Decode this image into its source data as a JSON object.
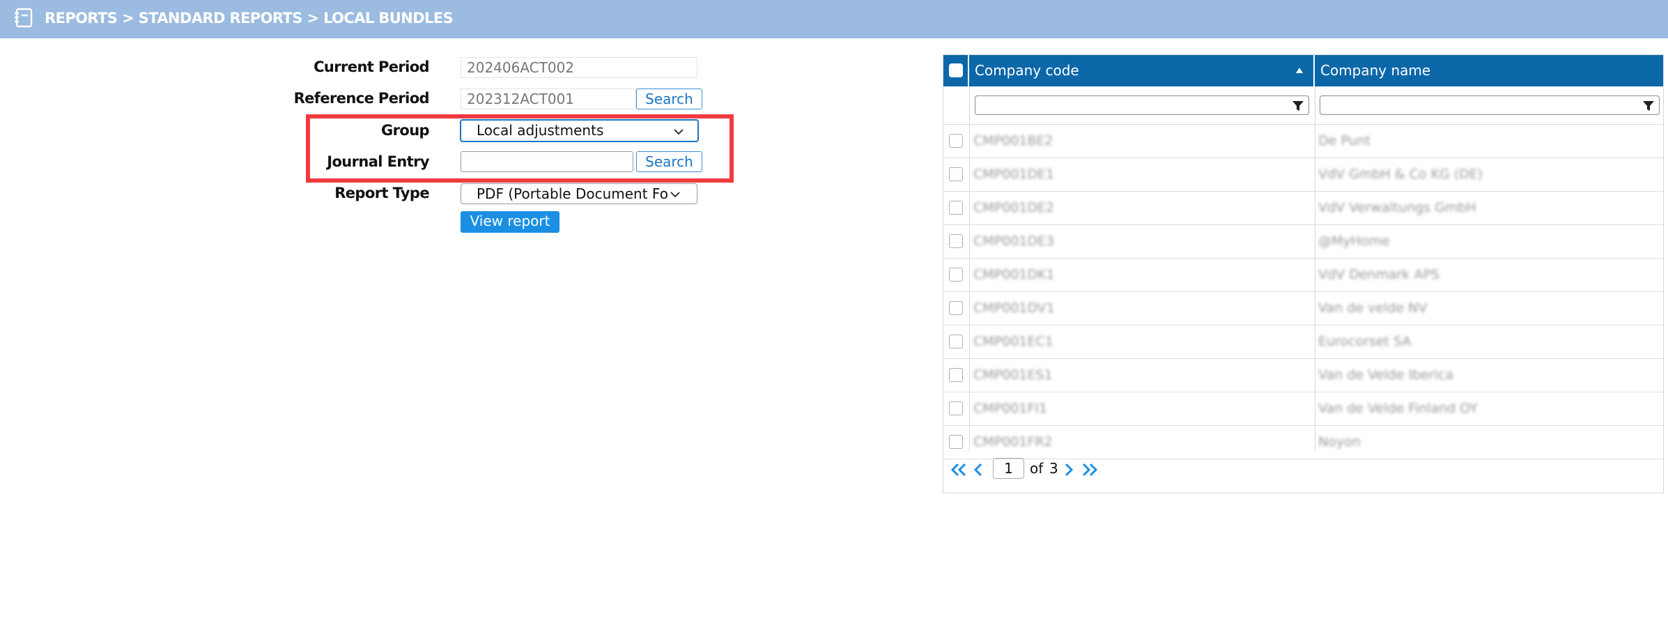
{
  "header": {
    "breadcrumb": "REPORTS > STANDARD REPORTS > LOCAL BUNDLES",
    "icon": "report-book-icon"
  },
  "form": {
    "current_period": {
      "label": "Current Period",
      "value": "202406ACT002"
    },
    "reference_period": {
      "label": "Reference Period",
      "value": "202312ACT001",
      "button": "Search"
    },
    "group": {
      "label": "Group",
      "value": "Local adjustments"
    },
    "journal_entry": {
      "label": "Journal Entry",
      "value": "",
      "button": "Search"
    },
    "report_type": {
      "label": "Report Type",
      "value": "PDF (Portable Document Forr"
    },
    "view_button": "View report"
  },
  "grid": {
    "columns": [
      {
        "label": "Company code",
        "sort": "ascending"
      },
      {
        "label": "Company name"
      }
    ],
    "rows": [
      {
        "code": "CMP001BE2",
        "name": "De Punt"
      },
      {
        "code": "CMP001DE1",
        "name": "VdV GmbH & Co KG (DE)"
      },
      {
        "code": "CMP001DE2",
        "name": "VdV Verwaltungs GmbH"
      },
      {
        "code": "CMP001DE3",
        "name": "@MyHome"
      },
      {
        "code": "CMP001DK1",
        "name": "VdV Denmark APS"
      },
      {
        "code": "CMP001DV1",
        "name": "Van de velde NV"
      },
      {
        "code": "CMP001EC1",
        "name": "Eurocorset SA"
      },
      {
        "code": "CMP001ES1",
        "name": "Van de Velde Iberica"
      },
      {
        "code": "CMP001FI1",
        "name": "Van de Velde Finland OY"
      },
      {
        "code": "CMP001FR2",
        "name": "Noyon"
      }
    ],
    "pager": {
      "page": "1",
      "of_label": "of",
      "total": "3"
    }
  },
  "colors": {
    "header_bg": "#9bbbe0",
    "grid_header_bg": "#0b67a8",
    "primary_button": "#1a8fe3",
    "highlight": "#ef3b3f"
  }
}
